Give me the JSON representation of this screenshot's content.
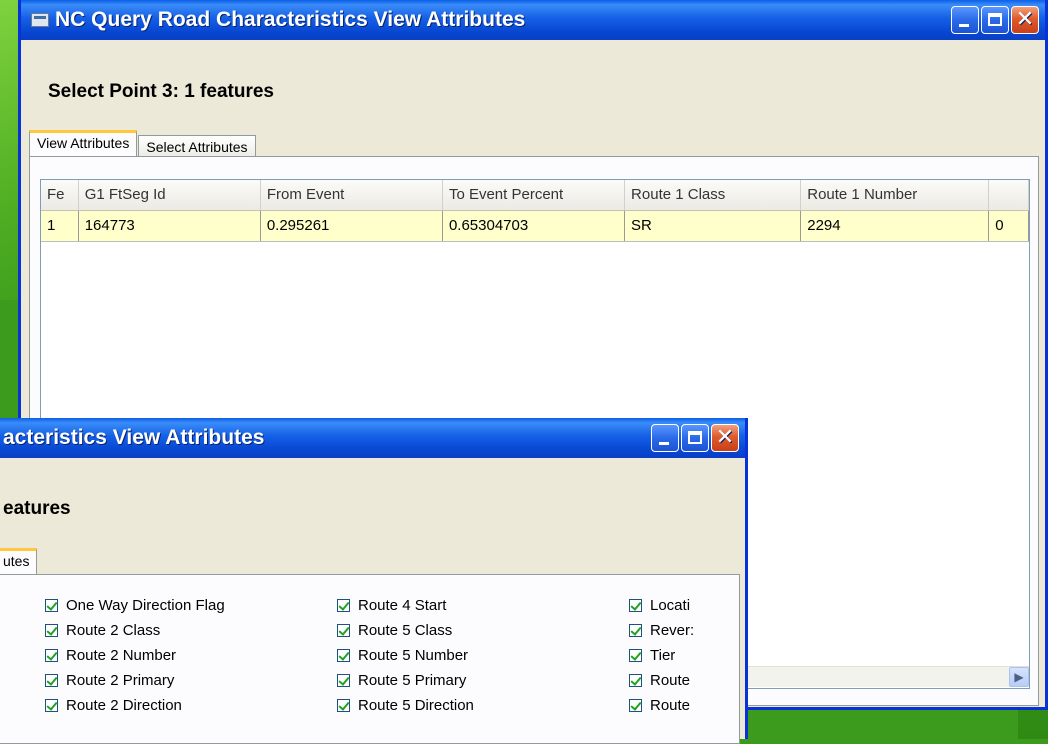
{
  "back_window": {
    "title": "NC Query Road Characteristics View Attributes",
    "heading": "Select Point 3: 1 features",
    "tabs": [
      {
        "label": "View Attributes",
        "active": true
      },
      {
        "label": "Select Attributes",
        "active": false
      }
    ],
    "grid": {
      "columns": [
        "Fe",
        "G1 FtSeg Id",
        "From Event",
        "To Event Percent",
        "Route 1 Class",
        "Route 1 Number",
        ""
      ],
      "rows": [
        [
          "1",
          "164773",
          "0.295261",
          "0.65304703",
          "SR",
          "2294",
          "0"
        ]
      ]
    }
  },
  "front_window": {
    "title": "acteristics View Attributes",
    "heading": "eatures",
    "tab_label": "utes",
    "checkboxes": {
      "col1": [
        "One Way Direction Flag",
        "Route 2 Class",
        "Route 2 Number",
        "Route 2 Primary",
        "Route 2 Direction"
      ],
      "col2": [
        "Route 4 Start",
        "Route 5 Class",
        "Route 5 Number",
        "Route 5 Primary",
        "Route 5 Direction"
      ],
      "col3": [
        "Locati",
        "Rever:",
        "Tier",
        "Route",
        "Route"
      ]
    }
  },
  "icons": {
    "minimize": "minimize-icon",
    "maximize": "maximize-icon",
    "close": "close-icon",
    "scroll_right": "chevron-right-icon"
  },
  "colors": {
    "titlebar": "#0a5fe8",
    "close_button": "#e05a2a",
    "selected_row": "#ffffcc",
    "active_tab_accent": "#ffc83c",
    "desktop": "#3c9a1c"
  }
}
